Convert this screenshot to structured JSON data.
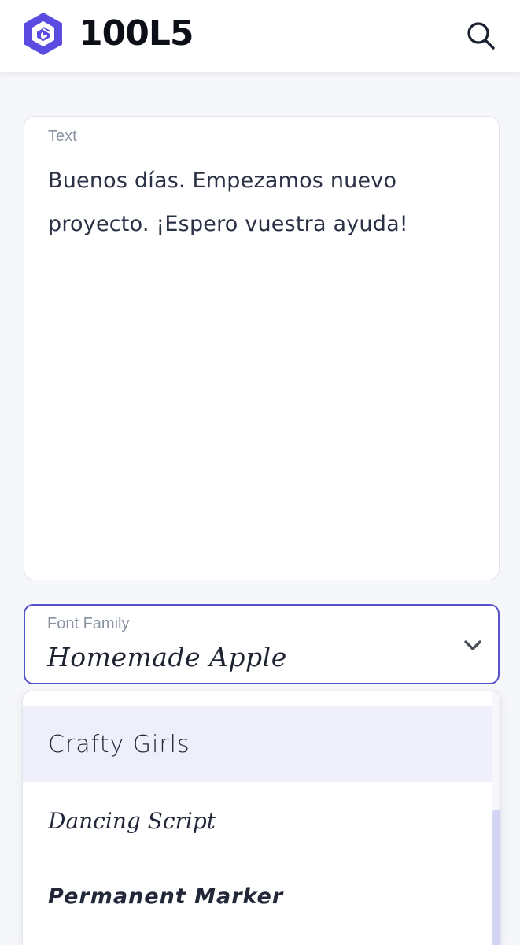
{
  "app": {
    "brand": "100L5",
    "brand_color": "#5b4be0"
  },
  "header": {
    "search_icon": "search-icon"
  },
  "text_field": {
    "label": "Text",
    "value": "Buenos días. Empezamos nuevo proyecto. ¡Espero vuestra ayuda!"
  },
  "font_field": {
    "label": "Font Family",
    "selected": "Homemade Apple",
    "accent_color": "#5453c9",
    "icon": "chevron-down-icon"
  },
  "dropdown": {
    "options": [
      {
        "label": "Crafty Girls",
        "highlighted": true
      },
      {
        "label": "Dancing Script",
        "highlighted": false
      },
      {
        "label": "Permanent Marker",
        "highlighted": false
      }
    ]
  }
}
